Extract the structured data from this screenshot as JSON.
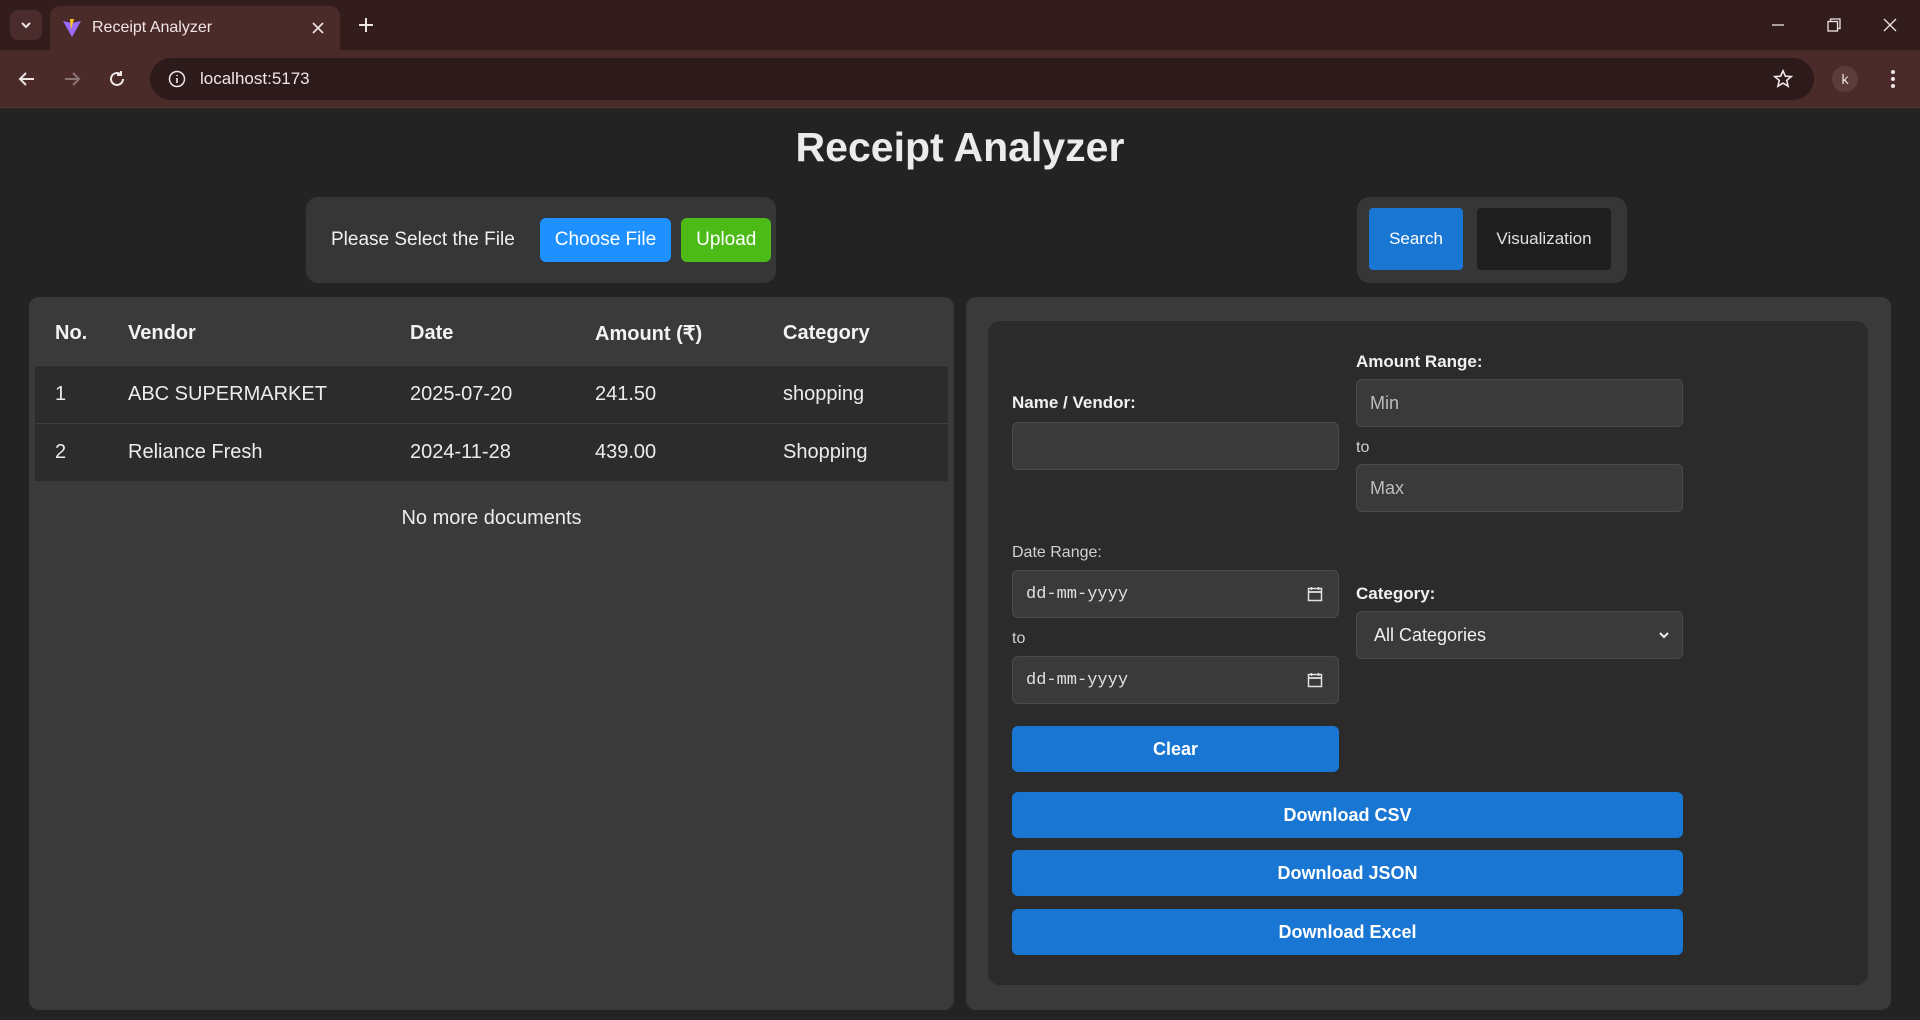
{
  "browser": {
    "tab_title": "Receipt Analyzer",
    "url": "localhost:5173",
    "profile_initial": "k"
  },
  "app": {
    "title": "Receipt Analyzer"
  },
  "upload": {
    "label": "Please Select the File",
    "choose_label": "Choose File",
    "upload_label": "Upload"
  },
  "modes": {
    "search_label": "Search",
    "visualization_label": "Visualization",
    "active": "Search"
  },
  "table": {
    "headers": [
      "No.",
      "Vendor",
      "Date",
      "Amount (₹)",
      "Category"
    ],
    "rows": [
      {
        "no": "1",
        "vendor": "ABC SUPERMARKET",
        "date": "2025-07-20",
        "amount": "241.50",
        "category": "shopping"
      },
      {
        "no": "2",
        "vendor": "Reliance Fresh",
        "date": "2024-11-28",
        "amount": "439.00",
        "category": "Shopping"
      }
    ],
    "footer": "No more documents"
  },
  "filters": {
    "vendor_label": "Name / Vendor:",
    "vendor_value": "",
    "amount_label": "Amount Range:",
    "amount_min_placeholder": "Min",
    "amount_to": "to",
    "amount_max_placeholder": "Max",
    "date_label": "Date Range:",
    "date_from_placeholder": "dd-mm-yyyy",
    "date_to": "to",
    "date_to_placeholder": "dd-mm-yyyy",
    "category_label": "Category:",
    "category_selected": "All Categories",
    "clear_label": "Clear",
    "csv_label": "Download CSV",
    "json_label": "Download JSON",
    "excel_label": "Download Excel"
  },
  "colors": {
    "primary_blue": "#1976d2",
    "choose_blue": "#1e90ff",
    "upload_green": "#4cbb17",
    "page_bg": "#232323",
    "chrome_bg": "#4b2a2a"
  }
}
